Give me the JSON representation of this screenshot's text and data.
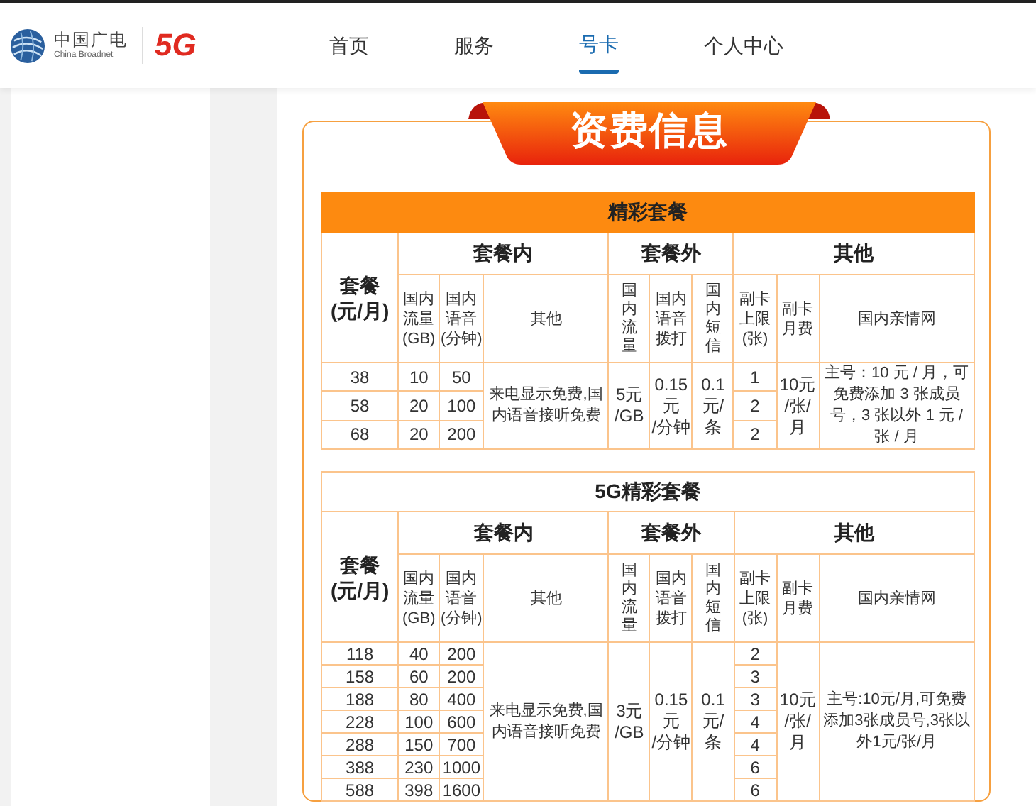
{
  "header": {
    "logo": {
      "brand_cn": "中国广电",
      "brand_en": "China Broadnet",
      "badge": "5G"
    },
    "nav": [
      {
        "label": "首页",
        "selected": false
      },
      {
        "label": "服务",
        "selected": false
      },
      {
        "label": "号卡",
        "selected": true
      },
      {
        "label": "个人中心",
        "selected": false
      }
    ]
  },
  "banner": {
    "title": "资费信息"
  },
  "tables": [
    {
      "title": "精彩套餐",
      "kind": "filled",
      "row_header": [
        "套餐",
        "(元/月)"
      ],
      "groups": [
        {
          "label": "套餐内",
          "columns": [
            {
              "label": "国内流量(GB)",
              "kind": "wrap"
            },
            {
              "label": "国内语音(分钟)",
              "kind": "wrap"
            },
            {
              "label": "其他",
              "kind": "wrap"
            }
          ]
        },
        {
          "label": "套餐外",
          "columns": [
            {
              "label": "国内流量",
              "kind": "vertical"
            },
            {
              "label": "国内语音拨打",
              "kind": "wrap"
            },
            {
              "label": "国内短信",
              "kind": "vertical"
            }
          ]
        },
        {
          "label": "其他",
          "columns": [
            {
              "label": "副卡上限(张)",
              "kind": "wrap"
            },
            {
              "label": "副卡月费",
              "kind": "wrap"
            },
            {
              "label": "国内亲情网",
              "kind": "wrap"
            }
          ]
        }
      ],
      "shared": {
        "in_other": "来电显示免费,国内语音接听免费",
        "out_data": [
          "5元",
          "/GB"
        ],
        "out_voice": [
          "0.15",
          "元",
          "/分钟"
        ],
        "out_sms": [
          "0.1",
          "元/",
          "条"
        ],
        "sub_card_fee": [
          "10元",
          "/张/",
          "月"
        ],
        "family_plan": "主号：10 元 / 月，可免费添加 3 张成员号，3 张以外 1 元 / 张 / 月"
      },
      "rows": [
        {
          "plan": "38",
          "data": "10",
          "voice": "50",
          "sub_card_limit": "1"
        },
        {
          "plan": "58",
          "data": "20",
          "voice": "100",
          "sub_card_limit": "2"
        },
        {
          "plan": "68",
          "data": "20",
          "voice": "200",
          "sub_card_limit": "2"
        }
      ]
    },
    {
      "title": "5G精彩套餐",
      "kind": "plain",
      "row_header": [
        "套餐",
        "(元/月)"
      ],
      "groups": [
        {
          "label": "套餐内",
          "columns": [
            {
              "label": "国内流量(GB)",
              "kind": "wrap"
            },
            {
              "label": "国内语音(分钟)",
              "kind": "wrap"
            },
            {
              "label": "其他",
              "kind": "wrap"
            }
          ]
        },
        {
          "label": "套餐外",
          "columns": [
            {
              "label": "国内流量",
              "kind": "vertical"
            },
            {
              "label": "国内语音拨打",
              "kind": "wrap"
            },
            {
              "label": "国内短信",
              "kind": "vertical"
            }
          ]
        },
        {
          "label": "其他",
          "columns": [
            {
              "label": "副卡上限(张)",
              "kind": "wrap"
            },
            {
              "label": "副卡月费",
              "kind": "wrap"
            },
            {
              "label": "国内亲情网",
              "kind": "wrap"
            }
          ]
        }
      ],
      "shared": {
        "in_other": "来电显示免费,国内语音接听免费",
        "out_data": [
          "3元",
          "/GB"
        ],
        "out_voice": [
          "0.15",
          "元",
          "/分钟"
        ],
        "out_sms": [
          "0.1",
          "元/",
          "条"
        ],
        "sub_card_fee": [
          "10元",
          "/张/",
          "月"
        ],
        "family_plan": "主号:10元/月,可免费添加3张成员号,3张以外1元/张/月"
      },
      "rows": [
        {
          "plan": "118",
          "data": "40",
          "voice": "200",
          "sub_card_limit": "2"
        },
        {
          "plan": "158",
          "data": "60",
          "voice": "200",
          "sub_card_limit": "3"
        },
        {
          "plan": "188",
          "data": "80",
          "voice": "400",
          "sub_card_limit": "3"
        },
        {
          "plan": "228",
          "data": "100",
          "voice": "600",
          "sub_card_limit": "4"
        },
        {
          "plan": "288",
          "data": "150",
          "voice": "700",
          "sub_card_limit": "4"
        },
        {
          "plan": "388",
          "data": "230",
          "voice": "1000",
          "sub_card_limit": "6"
        },
        {
          "plan": "588",
          "data": "398",
          "voice": "1600",
          "sub_card_limit": "6"
        }
      ]
    }
  ]
}
